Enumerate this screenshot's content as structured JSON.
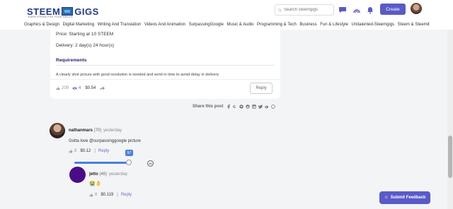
{
  "header": {
    "logo_left": "STEEM",
    "logo_right": "GIGS",
    "tagline": "EARN STEEM FOR YOUR SKILLS",
    "search_placeholder": "Search steemgigs",
    "create_label": "Create"
  },
  "nav": [
    "Graphics & Design",
    "Digital Marketing",
    "Writing And Translation",
    "Videos And Animation",
    "SurpassingGoogle",
    "Music & Audio",
    "Programming & Tech",
    "Business",
    "Fun & Lifestyle",
    "Unitalented-Steemgigs",
    "Steem & Steemit"
  ],
  "card": {
    "price": "Price: Starting at 10 STEEM",
    "delivery": "Delivery: 2 day(s) 24 hour(s)",
    "requirements_title": "Requirements",
    "requirements_text": "A clearly shot picture with good resolution is needed and send in time to avoid delay in delivery",
    "likes": "209",
    "views": "4",
    "value": "$0.54",
    "reply_label": "Reply"
  },
  "share": {
    "label": "Share this post"
  },
  "comment": {
    "author": "nathanmars",
    "reputation": "(70)",
    "time": "yesterday",
    "text": "Gotta love @surpassinggoogle picture",
    "votes": "0",
    "value": "$0.12",
    "separator": "|",
    "reply_label": "Reply",
    "vote_slider_value": "97"
  },
  "reply": {
    "author": "jetto",
    "reputation": "(46)",
    "time": "yesterday",
    "text": "😭👌",
    "votes": "0",
    "value": "$0.119",
    "separator": "|",
    "reply_label": "Reply"
  },
  "feedback": {
    "label": "Submit Feedback"
  },
  "colors": {
    "accent": "#5a5ac8",
    "slider": "#4a7ee0"
  }
}
